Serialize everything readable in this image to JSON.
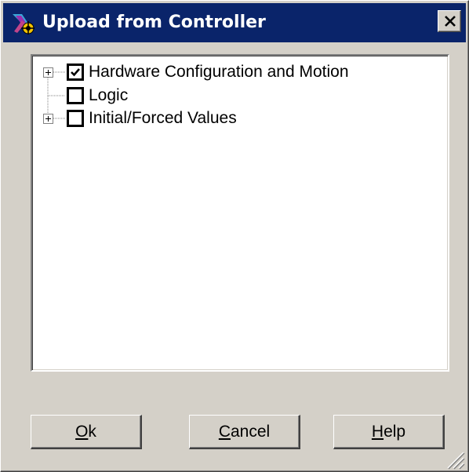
{
  "window": {
    "title": "Upload from Controller",
    "accent_color": "#0a246a",
    "face_color": "#d4d0c8"
  },
  "title_bar": {
    "app_icon": "controller-upload-icon",
    "close_icon": "close-icon"
  },
  "tree": {
    "items": [
      {
        "label": "Hardware Configuration and Motion",
        "checked": true,
        "expandable": true
      },
      {
        "label": "Logic",
        "checked": false,
        "expandable": false
      },
      {
        "label": "Initial/Forced Values",
        "checked": false,
        "expandable": true
      }
    ]
  },
  "buttons": {
    "ok": {
      "mnemonic": "O",
      "rest": "k"
    },
    "cancel": {
      "mnemonic": "C",
      "rest": "ancel"
    },
    "help": {
      "mnemonic": "H",
      "rest": "elp"
    }
  }
}
